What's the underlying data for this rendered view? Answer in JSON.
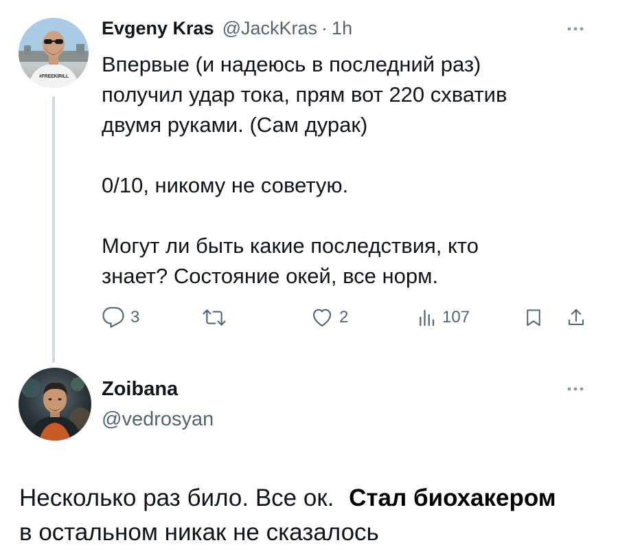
{
  "tweet1": {
    "author_name": "Evgeny Kras",
    "author_handle": "@JackKras",
    "separator": "·",
    "time": "1h",
    "body": [
      "Впервые (и надеюсь в последний раз)",
      "получил удар тока, прям вот 220 схватив",
      "двумя руками. (Сам дурак)",
      "0/10, никому не советую.",
      "Могут ли быть какие последствия, кто",
      "знает? Состояние окей, все норм."
    ],
    "avatar_shirt_text": "#FREEKIRILL",
    "actions": {
      "reply_count": "3",
      "repost_count": "",
      "like_count": "2",
      "views_count": "107"
    },
    "icons": [
      "reply-icon",
      "repost-icon",
      "like-icon",
      "views-icon",
      "bookmark-icon",
      "share-icon",
      "more-icon"
    ]
  },
  "tweet2": {
    "author_name": "Zoibana",
    "author_handle": "@vedrosyan",
    "reply_text_line1": "Несколько раз било. Все ок.",
    "overlay_caption": "Стал биохакером",
    "reply_text_line2": "в остальном никак не сказалось"
  },
  "colors": {
    "text_primary": "#0f1419",
    "text_secondary": "#536471",
    "thread_line": "#cfd9de",
    "background": "#ffffff"
  }
}
